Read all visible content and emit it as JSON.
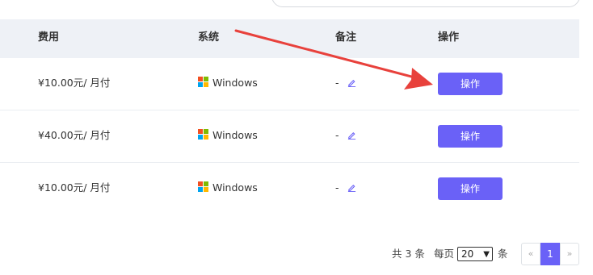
{
  "table": {
    "headers": [
      "费用",
      "系统",
      "备注",
      "操作"
    ],
    "rows": [
      {
        "fee": "¥10.00元/ 月付",
        "os": "Windows",
        "note": "-",
        "action": "操作"
      },
      {
        "fee": "¥40.00元/ 月付",
        "os": "Windows",
        "note": "-",
        "action": "操作"
      },
      {
        "fee": "¥10.00元/ 月付",
        "os": "Windows",
        "note": "-",
        "action": "操作"
      }
    ]
  },
  "pagination": {
    "total_text": "共 3 条",
    "per_page_label": "每页",
    "per_page_value": "20",
    "per_page_unit": "条",
    "prev": "«",
    "current_page": "1",
    "next": "»"
  },
  "colors": {
    "accent": "#6a61f7",
    "header_bg": "#eef1f6",
    "arrow": "#e8413c"
  },
  "icons": {
    "os": "windows-logo-icon",
    "note_edit": "pencil-icon"
  }
}
